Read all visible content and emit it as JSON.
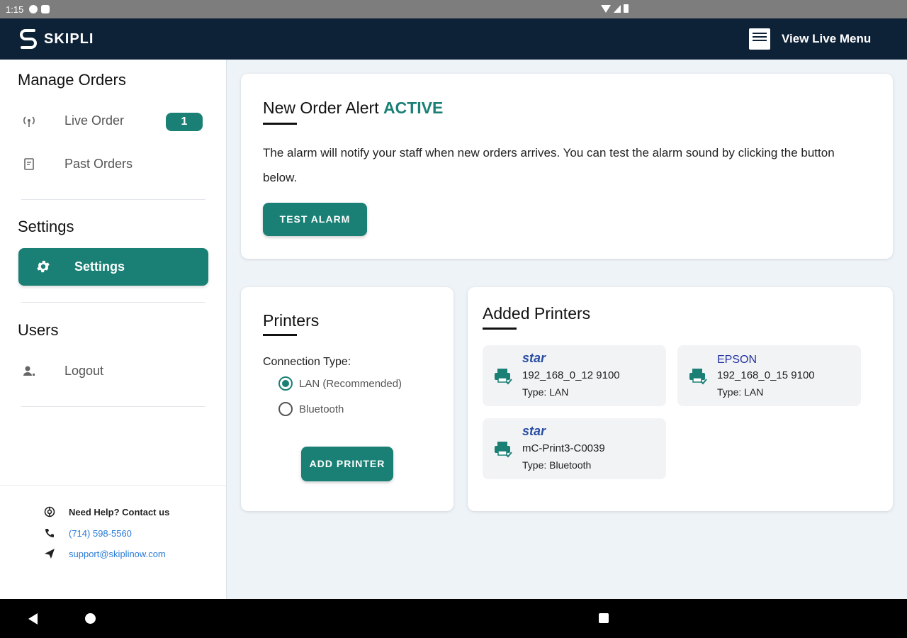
{
  "status_bar": {
    "time": "1:15"
  },
  "app_bar": {
    "brand": "SKIPLI",
    "view_live_menu": "View Live Menu"
  },
  "sidebar": {
    "manage_orders_title": "Manage Orders",
    "live_order_label": "Live Order",
    "live_order_count": "1",
    "past_orders_label": "Past Orders",
    "settings_title": "Settings",
    "settings_item_label": "Settings",
    "users_title": "Users",
    "logout_label": "Logout",
    "help": {
      "heading": "Need Help? Contact us",
      "phone": "(714) 598-5560",
      "email": "support@skiplinow.com"
    }
  },
  "alert_card": {
    "title_prefix": "New Order Alert",
    "status": "ACTIVE",
    "description": "The alarm will notify your staff when new orders arrives. You can test the alarm sound by clicking the button below.",
    "button": "TEST ALARM"
  },
  "printers_card": {
    "title": "Printers",
    "connection_label": "Connection Type:",
    "options": [
      "LAN (Recommended)",
      "Bluetooth"
    ],
    "selected": "LAN (Recommended)",
    "button": "ADD PRINTER"
  },
  "added_printers": {
    "title": "Added Printers",
    "items": [
      {
        "brand": "star",
        "name": "192_168_0_12 9100",
        "type": "Type: LAN"
      },
      {
        "brand": "EPSON",
        "name": "192_168_0_15 9100",
        "type": "Type: LAN"
      },
      {
        "brand": "star",
        "name": "mC-Print3-C0039",
        "type": "Type: Bluetooth"
      }
    ]
  },
  "colors": {
    "brand_dark": "#0d2137",
    "accent": "#1a8075",
    "link": "#2a7bd6"
  }
}
